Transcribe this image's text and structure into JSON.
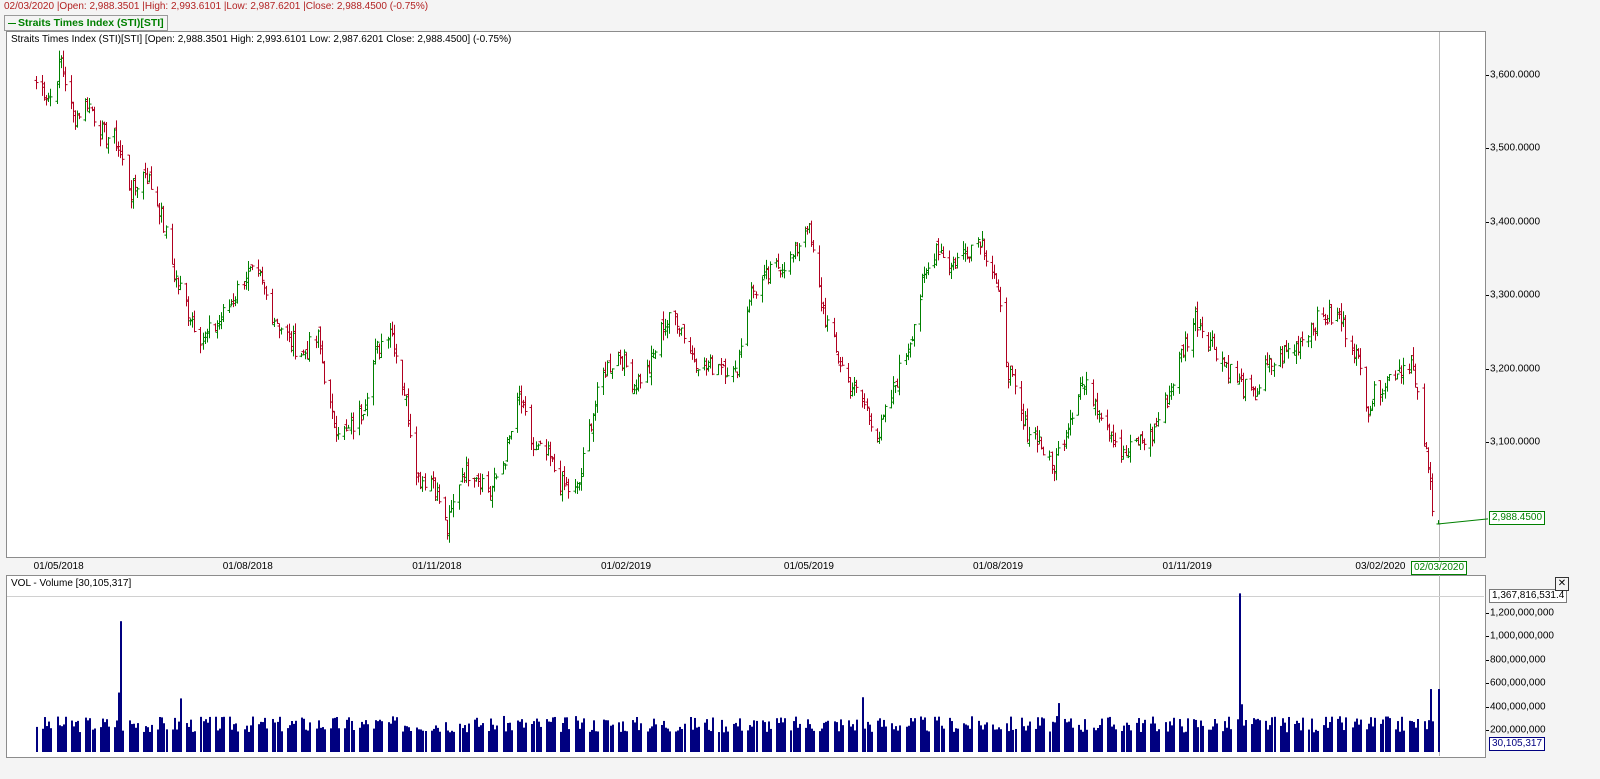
{
  "header": {
    "info_line": "02/03/2020 |Open: 2,988.3501 |High: 2,993.6101 |Low: 2,987.6201 |Close: 2,988.4500 (-0.75%)",
    "legend_label": "Straits Times Index (STI)[STI]"
  },
  "price_panel": {
    "title": "Straits Times Index (STI)[STI] [Open: 2,988.3501  High: 2,993.6101  Low: 2,987.6201  Close: 2,988.4500] (-0.75%)",
    "last_close_label": "2,988.4500",
    "current_date_label": "02/03/2020"
  },
  "volume_panel": {
    "title": "VOL - Volume [30,105,317]",
    "max_label": "1,367,816,531.4",
    "last_label": "30,105,317",
    "close_glyph": "✕"
  },
  "colors": {
    "up": "#008000",
    "down": "#b00020",
    "volume": "#000080",
    "accent": "#008000"
  },
  "chart_data": [
    {
      "type": "ohlc",
      "title": "Straits Times Index (STI)[STI]",
      "x_tick_labels": [
        "01/05/2018",
        "01/08/2018",
        "01/11/2018",
        "01/02/2019",
        "01/05/2019",
        "01/08/2019",
        "01/11/2019",
        "03/02/2020"
      ],
      "y_tick_labels": [
        "3,600.0000",
        "3,500.0000",
        "3,400.0000",
        "3,300.0000",
        "3,200.0000",
        "3,100.0000"
      ],
      "y_ticks": [
        3600,
        3500,
        3400,
        3300,
        3200,
        3100
      ],
      "ylim": [
        2950,
        3665
      ],
      "date_range": [
        "2018-04-20",
        "2020-03-02"
      ],
      "last": {
        "date": "02/03/2020",
        "open": 2988.3501,
        "high": 2993.6101,
        "low": 2987.6201,
        "close": 2988.45
      },
      "close_path": [
        {
          "date": "2018-04-20",
          "close": 3590
        },
        {
          "date": "2018-04-27",
          "close": 3570
        },
        {
          "date": "2018-05-02",
          "close": 3620
        },
        {
          "date": "2018-05-08",
          "close": 3540
        },
        {
          "date": "2018-05-15",
          "close": 3565
        },
        {
          "date": "2018-05-22",
          "close": 3520
        },
        {
          "date": "2018-05-29",
          "close": 3510
        },
        {
          "date": "2018-06-05",
          "close": 3440
        },
        {
          "date": "2018-06-12",
          "close": 3470
        },
        {
          "date": "2018-06-19",
          "close": 3420
        },
        {
          "date": "2018-06-26",
          "close": 3330
        },
        {
          "date": "2018-07-03",
          "close": 3280
        },
        {
          "date": "2018-07-10",
          "close": 3240
        },
        {
          "date": "2018-07-17",
          "close": 3260
        },
        {
          "date": "2018-07-24",
          "close": 3290
        },
        {
          "date": "2018-07-31",
          "close": 3330
        },
        {
          "date": "2018-08-07",
          "close": 3320
        },
        {
          "date": "2018-08-14",
          "close": 3270
        },
        {
          "date": "2018-08-21",
          "close": 3240
        },
        {
          "date": "2018-08-28",
          "close": 3220
        },
        {
          "date": "2018-09-04",
          "close": 3240
        },
        {
          "date": "2018-09-11",
          "close": 3130
        },
        {
          "date": "2018-09-18",
          "close": 3110
        },
        {
          "date": "2018-09-25",
          "close": 3140
        },
        {
          "date": "2018-10-02",
          "close": 3220
        },
        {
          "date": "2018-10-09",
          "close": 3260
        },
        {
          "date": "2018-10-16",
          "close": 3170
        },
        {
          "date": "2018-10-23",
          "close": 3050
        },
        {
          "date": "2018-10-30",
          "close": 3050
        },
        {
          "date": "2018-11-06",
          "close": 2980
        },
        {
          "date": "2018-11-13",
          "close": 3060
        },
        {
          "date": "2018-11-20",
          "close": 3060
        },
        {
          "date": "2018-11-27",
          "close": 3030
        },
        {
          "date": "2018-12-04",
          "close": 3080
        },
        {
          "date": "2018-12-11",
          "close": 3160
        },
        {
          "date": "2018-12-18",
          "close": 3090
        },
        {
          "date": "2018-12-25",
          "close": 3080
        },
        {
          "date": "2019-01-01",
          "close": 3040
        },
        {
          "date": "2019-01-08",
          "close": 3030
        },
        {
          "date": "2019-01-15",
          "close": 3130
        },
        {
          "date": "2019-01-22",
          "close": 3200
        },
        {
          "date": "2019-01-29",
          "close": 3220
        },
        {
          "date": "2019-02-05",
          "close": 3180
        },
        {
          "date": "2019-02-12",
          "close": 3200
        },
        {
          "date": "2019-02-19",
          "close": 3260
        },
        {
          "date": "2019-02-26",
          "close": 3270
        },
        {
          "date": "2019-03-05",
          "close": 3220
        },
        {
          "date": "2019-03-12",
          "close": 3200
        },
        {
          "date": "2019-03-19",
          "close": 3210
        },
        {
          "date": "2019-03-26",
          "close": 3190
        },
        {
          "date": "2019-04-02",
          "close": 3300
        },
        {
          "date": "2019-04-09",
          "close": 3320
        },
        {
          "date": "2019-04-16",
          "close": 3340
        },
        {
          "date": "2019-04-23",
          "close": 3350
        },
        {
          "date": "2019-04-30",
          "close": 3400
        },
        {
          "date": "2019-05-07",
          "close": 3290
        },
        {
          "date": "2019-05-14",
          "close": 3220
        },
        {
          "date": "2019-05-21",
          "close": 3180
        },
        {
          "date": "2019-05-28",
          "close": 3150
        },
        {
          "date": "2019-06-04",
          "close": 3110
        },
        {
          "date": "2019-06-11",
          "close": 3170
        },
        {
          "date": "2019-06-18",
          "close": 3230
        },
        {
          "date": "2019-06-25",
          "close": 3310
        },
        {
          "date": "2019-07-02",
          "close": 3370
        },
        {
          "date": "2019-07-09",
          "close": 3340
        },
        {
          "date": "2019-07-16",
          "close": 3360
        },
        {
          "date": "2019-07-23",
          "close": 3380
        },
        {
          "date": "2019-07-30",
          "close": 3330
        },
        {
          "date": "2019-08-06",
          "close": 3200
        },
        {
          "date": "2019-08-13",
          "close": 3120
        },
        {
          "date": "2019-08-20",
          "close": 3110
        },
        {
          "date": "2019-08-27",
          "close": 3060
        },
        {
          "date": "2019-09-03",
          "close": 3120
        },
        {
          "date": "2019-09-10",
          "close": 3180
        },
        {
          "date": "2019-09-17",
          "close": 3160
        },
        {
          "date": "2019-09-24",
          "close": 3120
        },
        {
          "date": "2019-10-01",
          "close": 3080
        },
        {
          "date": "2019-10-08",
          "close": 3100
        },
        {
          "date": "2019-10-15",
          "close": 3110
        },
        {
          "date": "2019-10-22",
          "close": 3160
        },
        {
          "date": "2019-10-29",
          "close": 3220
        },
        {
          "date": "2019-11-05",
          "close": 3270
        },
        {
          "date": "2019-11-12",
          "close": 3240
        },
        {
          "date": "2019-11-19",
          "close": 3210
        },
        {
          "date": "2019-11-26",
          "close": 3180
        },
        {
          "date": "2019-12-03",
          "close": 3160
        },
        {
          "date": "2019-12-10",
          "close": 3200
        },
        {
          "date": "2019-12-17",
          "close": 3220
        },
        {
          "date": "2019-12-24",
          "close": 3230
        },
        {
          "date": "2019-12-31",
          "close": 3260
        },
        {
          "date": "2020-01-07",
          "close": 3270
        },
        {
          "date": "2020-01-14",
          "close": 3270
        },
        {
          "date": "2020-01-21",
          "close": 3230
        },
        {
          "date": "2020-01-28",
          "close": 3150
        },
        {
          "date": "2020-02-04",
          "close": 3180
        },
        {
          "date": "2020-02-11",
          "close": 3200
        },
        {
          "date": "2020-02-18",
          "close": 3210
        },
        {
          "date": "2020-02-24",
          "close": 3100
        },
        {
          "date": "2020-02-28",
          "close": 3020
        },
        {
          "date": "2020-03-02",
          "close": 2988.45
        }
      ]
    },
    {
      "type": "bar",
      "title": "VOL - Volume [30,105,317]",
      "y_tick_labels": [
        "1,200,000,000",
        "1,000,000,000",
        "800,000,000",
        "600,000,000",
        "400,000,000",
        "200,000,000"
      ],
      "y_ticks": [
        1200000000,
        1000000000,
        800000000,
        600000000,
        400000000,
        200000000
      ],
      "ylim": [
        0,
        1400000000
      ],
      "max_value": 1367816531.4,
      "last_value": 30105317,
      "baseline": 250000000,
      "spikes": [
        {
          "date": "2018-05-31",
          "value": 1130000000
        },
        {
          "date": "2018-05-30",
          "value": 520000000
        },
        {
          "date": "2018-06-29",
          "value": 470000000
        },
        {
          "date": "2019-05-27",
          "value": 480000000
        },
        {
          "date": "2019-08-30",
          "value": 430000000
        },
        {
          "date": "2019-11-26",
          "value": 1367816531.4
        },
        {
          "date": "2019-11-27",
          "value": 420000000
        },
        {
          "date": "2020-02-27",
          "value": 550000000
        }
      ]
    }
  ]
}
